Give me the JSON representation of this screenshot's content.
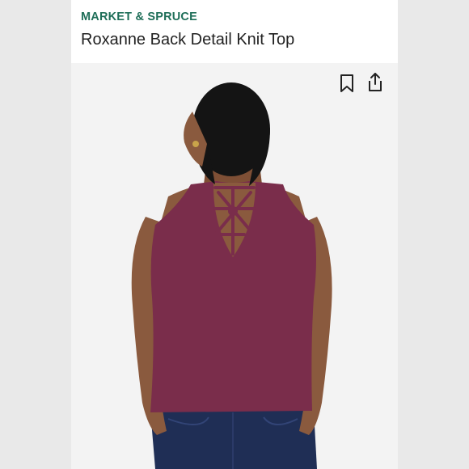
{
  "listing": {
    "brand": "MARKET & SPRUCE",
    "title": "Roxanne Back Detail Knit Top"
  },
  "actions": {
    "bookmark_icon": "bookmark-icon",
    "share_icon": "share-icon"
  },
  "colors": {
    "brand": "#1e6e58",
    "top": "#7a2d4b",
    "jeans": "#1f2e55"
  }
}
